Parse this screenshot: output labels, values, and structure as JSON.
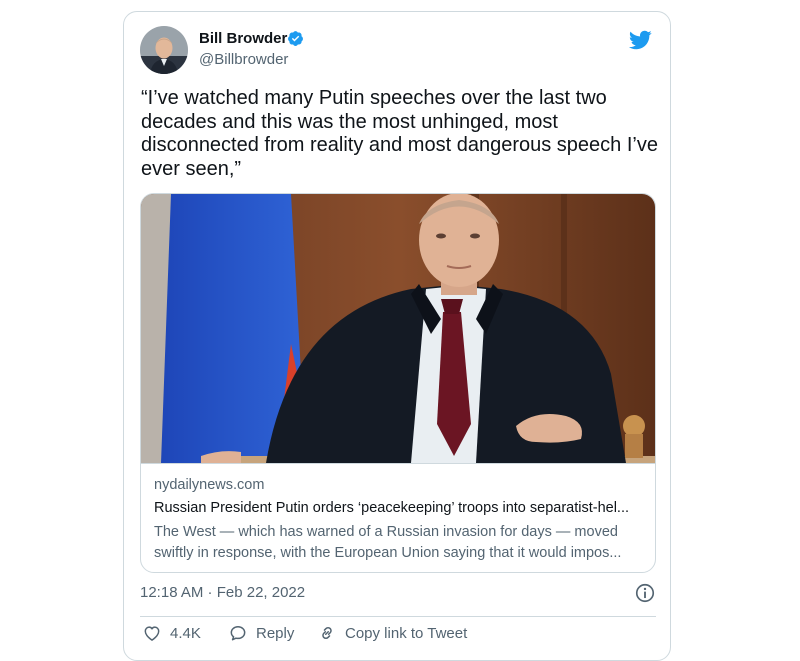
{
  "tweet": {
    "display_name": "Bill Browder",
    "handle": "@Billbrowder",
    "text": "“I’ve watched many Putin speeches over the last two decades and this was the most unhinged, most disconnected from reality and most dangerous speech I’ve ever seen,”",
    "timestamp": "12:18 AM · Feb 22, 2022"
  },
  "card": {
    "domain": "nydailynews.com",
    "title": "Russian President Putin orders ‘peacekeeping’ troops into separatist-hel...",
    "description_line1": "The West — which has warned of a Russian invasion for days — moved",
    "description_line2": "swiftly in response, with the European Union saying that it would impos..."
  },
  "actions": {
    "like_count": "4.4K",
    "reply_label": "Reply",
    "copy_link_label": "Copy link to Tweet"
  },
  "icons": {
    "verified": "verified-badge-icon",
    "brand": "twitter-bird-icon",
    "info": "info-icon",
    "like": "heart-icon",
    "reply": "speech-bubble-icon",
    "copy_link": "link-icon"
  },
  "colors": {
    "accent": "#1d9bf0",
    "text": "#0f1419",
    "muted": "#536471",
    "border": "#cfd9de"
  }
}
